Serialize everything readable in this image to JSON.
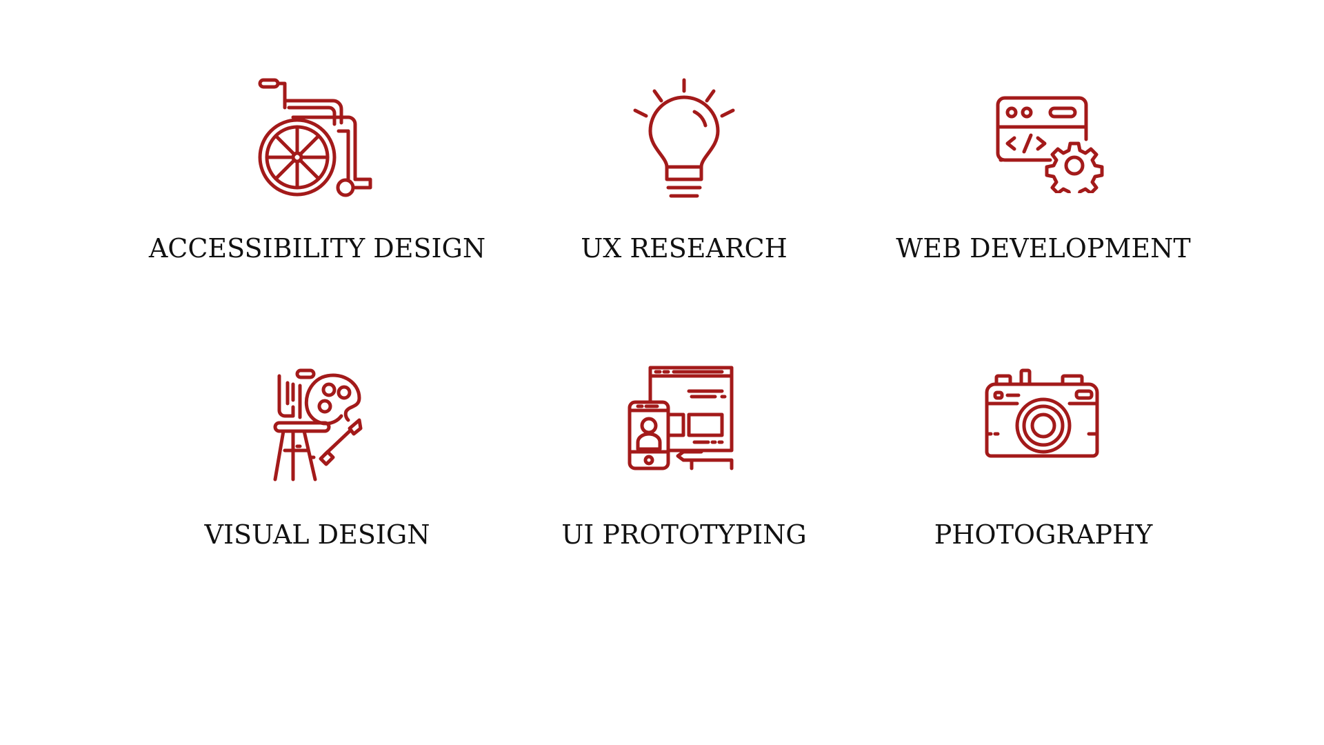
{
  "accent_color": "#A31A1A",
  "skills": [
    {
      "label": "ACCESSIBILITY DESIGN",
      "icon": "wheelchair-icon"
    },
    {
      "label": "UX RESEARCH",
      "icon": "lightbulb-icon"
    },
    {
      "label": "WEB DEVELOPMENT",
      "icon": "code-window-gear-icon"
    },
    {
      "label": "VISUAL DESIGN",
      "icon": "easel-palette-icon"
    },
    {
      "label": "UI PROTOTYPING",
      "icon": "wireframe-devices-icon"
    },
    {
      "label": "PHOTOGRAPHY",
      "icon": "camera-icon"
    }
  ]
}
